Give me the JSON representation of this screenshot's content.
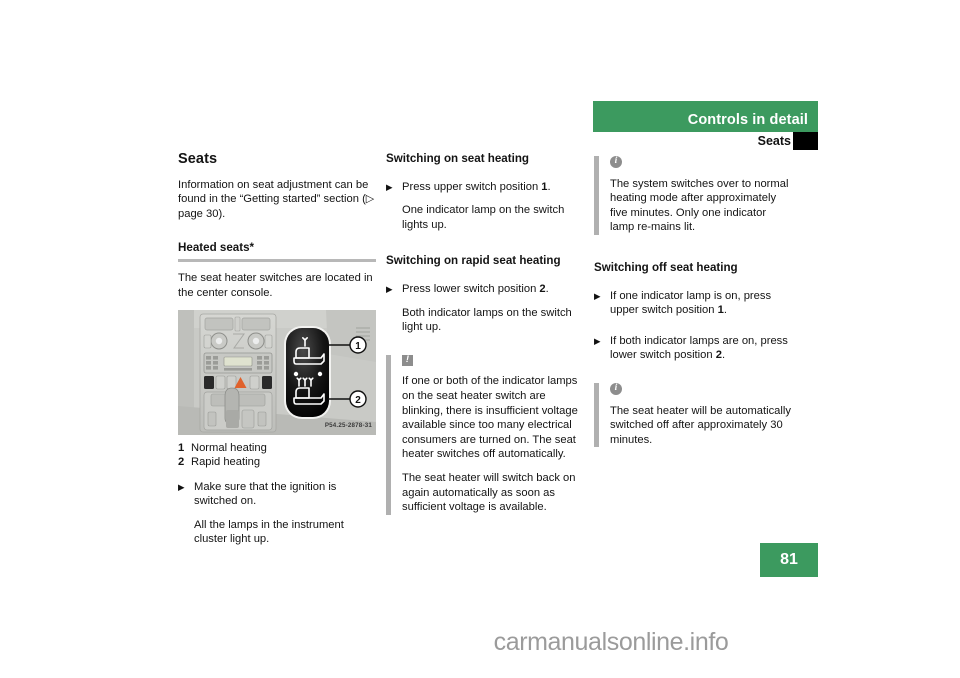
{
  "header": {
    "chapter_title": "Controls in detail",
    "section_title": "Seats",
    "tab_icon": "black-tab-marker"
  },
  "page_number": "81",
  "watermark": "carmanualsonline.info",
  "column_left": {
    "title": "Seats",
    "intro": "Information on seat adjustment can be found in the “Getting started” section (▷ page 30).",
    "subhead": "Heated seats*",
    "body": "The seat heater switches are located in the center console.",
    "figure": {
      "code": "P54.25-2878-31",
      "callout_1": "1",
      "callout_2": "2",
      "alt": "center-console-seat-heater-switch"
    },
    "legend": [
      {
        "num": "1",
        "text": "Normal heating"
      },
      {
        "num": "2",
        "text": "Rapid heating"
      }
    ],
    "instruction": {
      "marker": "▶",
      "line1": "Make sure that the ignition is switched on.",
      "line2": "All the lamps in the instrument cluster light up."
    }
  },
  "column_middle": {
    "heading_1": "Switching on seat heating",
    "step_1": {
      "marker": "▶",
      "text_pre": "Press upper switch position ",
      "text_bold": "1",
      "text_post": ".",
      "result": "One indicator lamp on the switch lights up."
    },
    "heading_2": "Switching on rapid seat heating",
    "step_2": {
      "marker": "▶",
      "text_pre": "Press lower switch position ",
      "text_bold": "2",
      "text_post": ".",
      "result": "Both indicator lamps on the switch light up."
    },
    "warning": {
      "icon": "warning-icon",
      "para_1": "If one or both of the indicator lamps on the seat heater switch are blinking, there is insufficient voltage available since too many electrical consumers are turned on. The seat heater switches off automatically.",
      "para_2": "The seat heater will switch back on again automatically as soon as sufficient voltage is available."
    }
  },
  "column_right": {
    "info_1": {
      "icon": "info-icon",
      "text": "The system switches over to normal heating mode after approximately five minutes. Only one indicator lamp re‑mains lit."
    },
    "heading": "Switching off seat heating",
    "step_1": {
      "marker": "▶",
      "text_pre": "If one indicator lamp is on, press upper switch position ",
      "text_bold": "1",
      "text_post": "."
    },
    "step_2": {
      "marker": "▶",
      "text_pre": "If both indicator lamps are on, press lower switch position ",
      "text_bold": "2",
      "text_post": "."
    },
    "info_2": {
      "icon": "info-icon",
      "text": "The seat heater will be automatically switched off after approximately 30 minutes."
    }
  },
  "colors": {
    "accent_green": "#3c9a5f",
    "rule_gray": "#b8b8b8",
    "note_bar_gray": "#b0b0b0",
    "watermark_gray": "#9b9b9b"
  }
}
